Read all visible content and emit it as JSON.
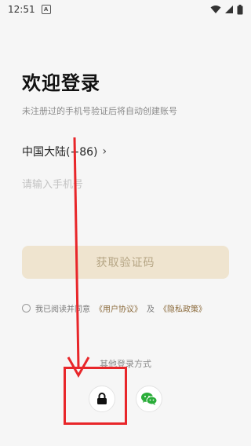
{
  "status_bar": {
    "time": "12:51",
    "notification_icon": "A"
  },
  "login": {
    "title": "欢迎登录",
    "subtitle": "未注册过的手机号验证后将自动创建账号",
    "region": "中国大陆(+86)",
    "phone_placeholder": "请输入手机号",
    "get_code_label": "获取验证码"
  },
  "agreement": {
    "prefix": "我已阅读并同意",
    "user_agreement": "《用户协议》",
    "connector": "及",
    "privacy_policy": "《隐私政策》"
  },
  "other_login": {
    "label": "其他登录方式",
    "methods": [
      "lock-icon",
      "wechat-icon"
    ]
  },
  "annotation": {
    "color": "#e8262a"
  }
}
